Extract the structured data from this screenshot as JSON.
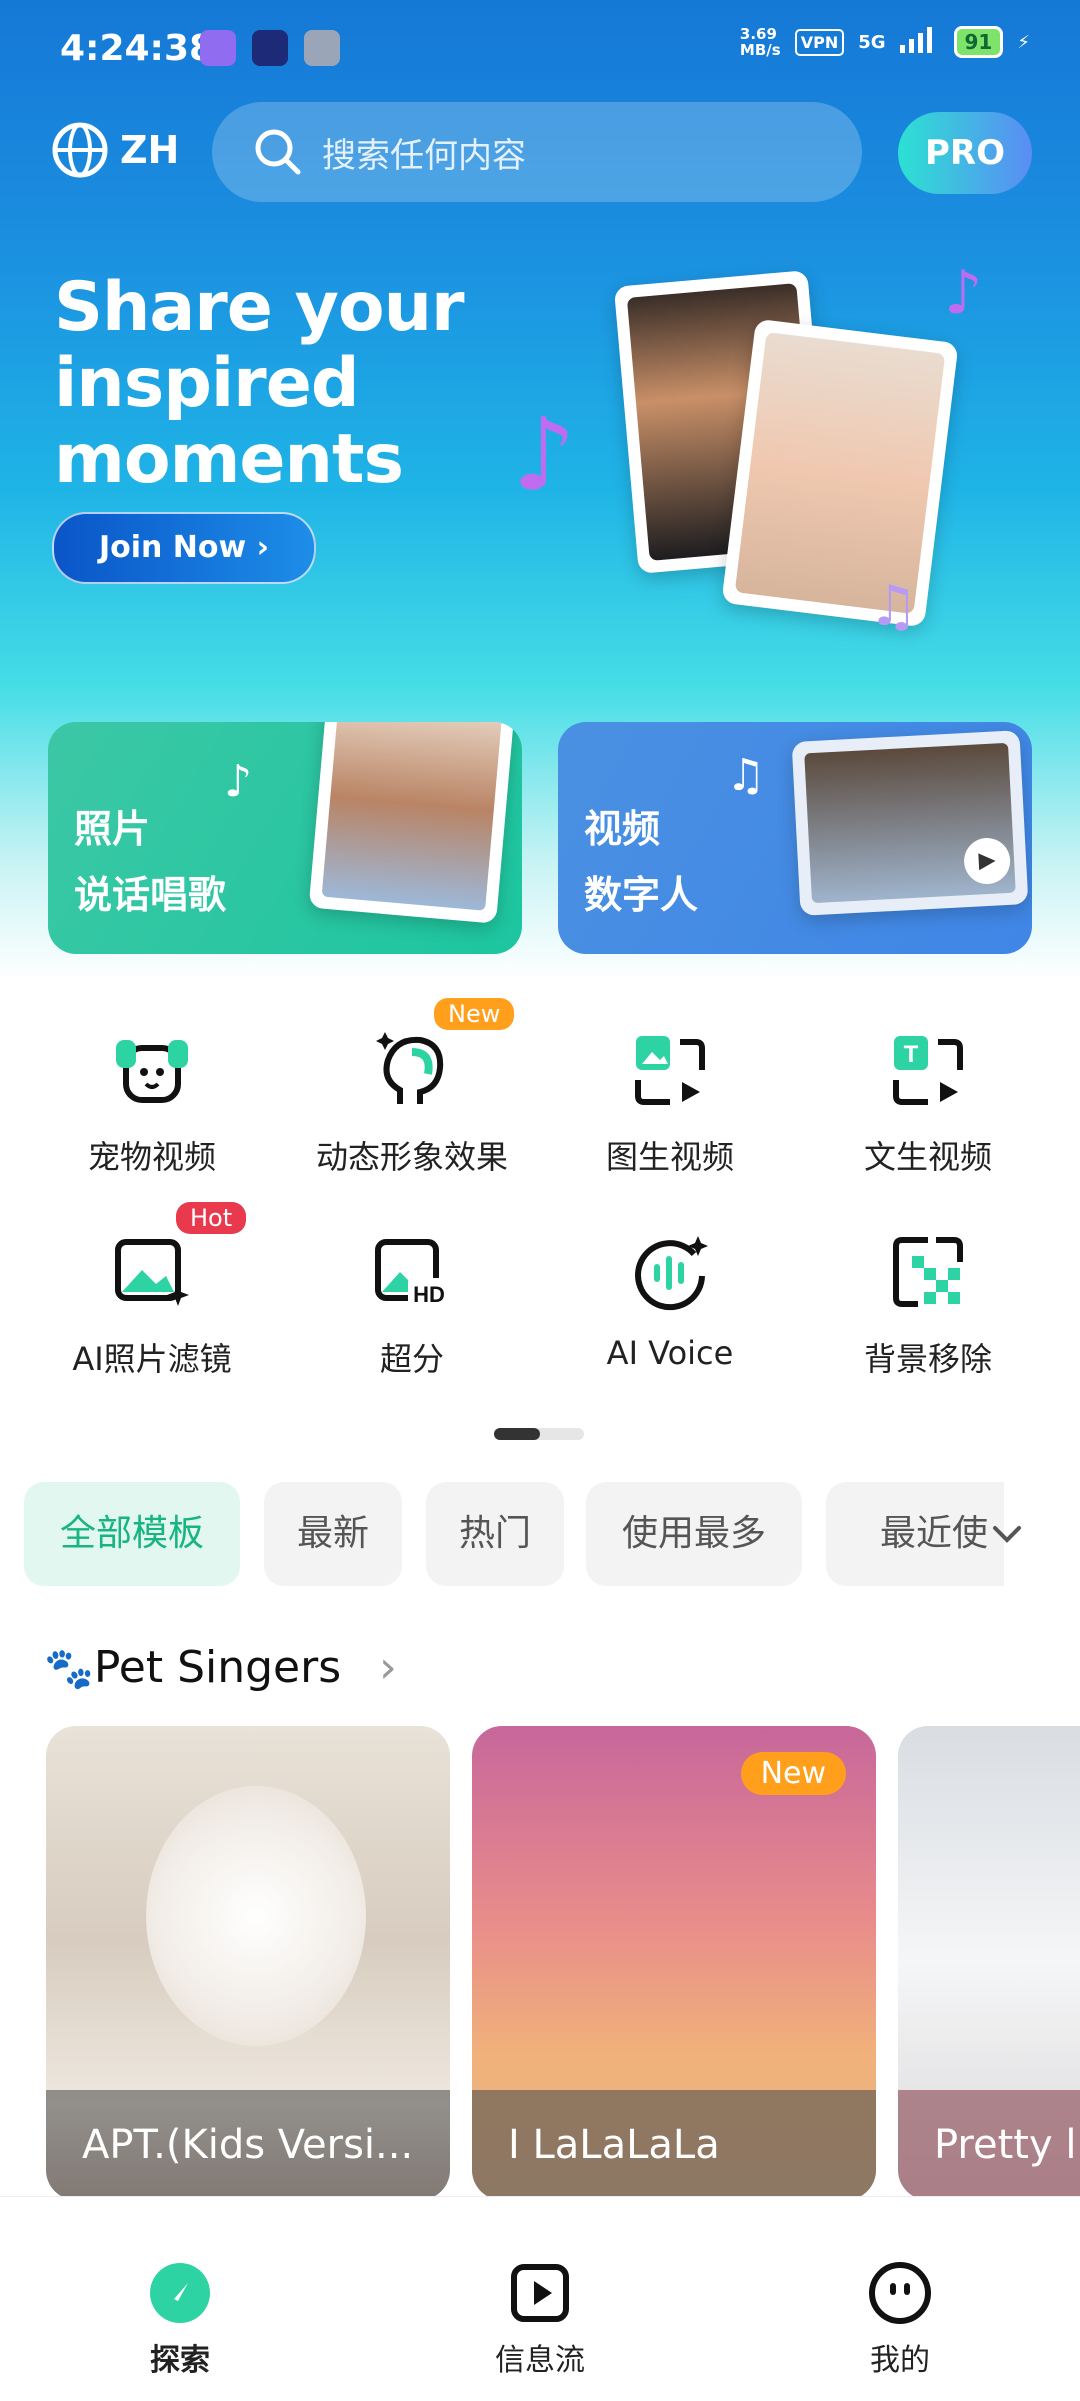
{
  "status_bar": {
    "time": "4:24:38",
    "net_speed": "3.69\nMB/s",
    "vpn": "VPN",
    "signal": "5G",
    "battery": "91"
  },
  "header": {
    "language": "ZH",
    "search_placeholder": "搜索任何内容",
    "pro_label": "PRO"
  },
  "banner": {
    "headline_1": "Share your",
    "headline_2": "inspired",
    "headline_3": "moments",
    "join_label": "Join Now ›"
  },
  "big_cards": [
    {
      "line1": "照片",
      "line2": "说话唱歌"
    },
    {
      "line1": "视频",
      "line2": "数字人"
    }
  ],
  "features": [
    {
      "label": "宠物视频"
    },
    {
      "label": "动态形象效果",
      "badge": "New"
    },
    {
      "label": "图生视频"
    },
    {
      "label": "文生视频"
    },
    {
      "label": "AI照片滤镜",
      "badge": "Hot"
    },
    {
      "label": "超分"
    },
    {
      "label": "AI Voice"
    },
    {
      "label": "背景移除"
    }
  ],
  "chips": [
    "全部模板",
    "最新",
    "热门",
    "使用最多",
    "最近使"
  ],
  "section": {
    "title": "Pet Singers",
    "emoji": "🐾"
  },
  "templates": [
    {
      "title": "APT.(Kids Versi..."
    },
    {
      "title": "I LaLaLaLa",
      "badge": "New"
    },
    {
      "title": "Pretty li"
    }
  ],
  "bottom_nav": [
    {
      "label": "探索"
    },
    {
      "label": "信息流"
    },
    {
      "label": "我的"
    }
  ],
  "colors": {
    "accent": "#17b57f",
    "hot": "#e8394d",
    "new": "#ff9f1c"
  }
}
